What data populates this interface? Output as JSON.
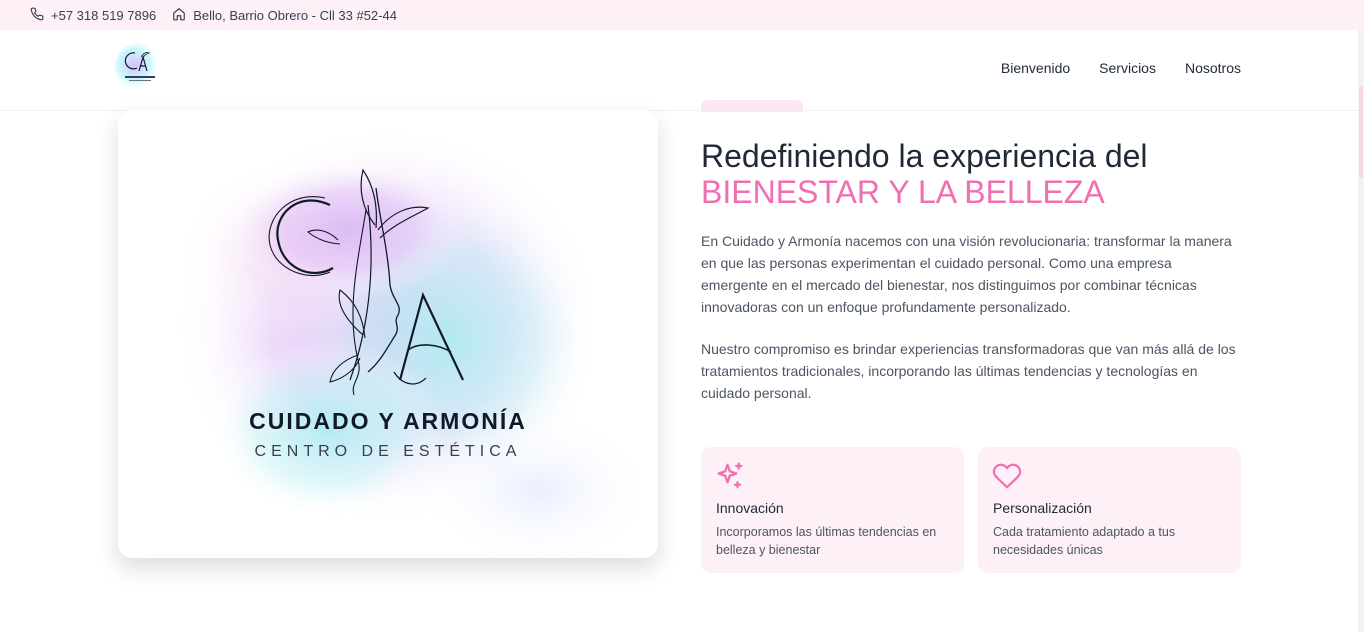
{
  "topbar": {
    "phone": "+57 318 519 7896",
    "address": "Bello, Barrio Obrero - Cll 33 #52-44",
    "icons": {
      "phone": "phone-icon",
      "address": "home-icon"
    }
  },
  "header": {
    "nav": [
      "Bienvenido",
      "Servicios",
      "Nosotros"
    ]
  },
  "logo": {
    "title": "CUIDADO Y ARMONÍA",
    "subtitle": "CENTRO DE ESTÉTICA"
  },
  "hero": {
    "headline": "Redefiniendo la experiencia del",
    "headline_accent": "BIENESTAR Y LA BELLEZA",
    "paragraph1": "En Cuidado y Armonía nacemos con una visión revolucionaria: transformar la manera en que las personas experimentan el cuidado personal. Como una empresa emergente en el mercado del bienestar, nos distinguimos por combinar técnicas innovadoras con un enfoque profundamente personalizado.",
    "paragraph2": "Nuestro compromiso es brindar experiencias transformadoras que van más allá de los tratamientos tradicionales, incorporando las últimas tendencias y tecnologías en cuidado personal."
  },
  "features": [
    {
      "icon": "sparkles-icon",
      "title": "Innovación",
      "description": "Incorporamos las últimas tendencias en belleza y bienestar"
    },
    {
      "icon": "heart-icon",
      "title": "Personalización",
      "description": "Cada tratamiento adaptado a tus necesidades únicas"
    }
  ],
  "colors": {
    "accent": "#f06fb2",
    "topbar_bg": "#fdf0f6",
    "card_bg": "#fdf0f6",
    "text": "#1f2937",
    "muted": "#4b5563"
  }
}
